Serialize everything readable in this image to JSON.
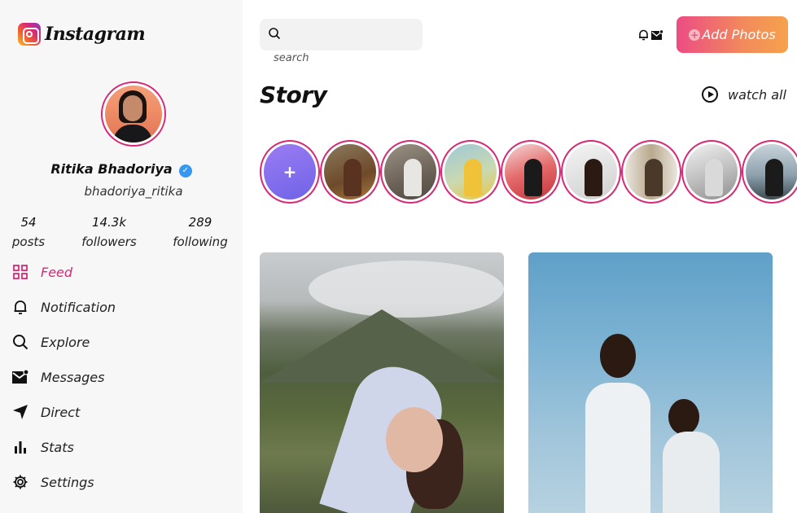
{
  "brand": {
    "name": "Instagram",
    "logo_icon": "instagram-logo-icon"
  },
  "profile": {
    "name": "Ritika Bhadoriya",
    "handle": "bhadoriya_ritika",
    "verified": true,
    "stats": [
      {
        "value": "54",
        "label": "posts"
      },
      {
        "value": "14.3k",
        "label": "followers"
      },
      {
        "value": "289",
        "label": "following"
      }
    ]
  },
  "nav": [
    {
      "label": "Feed",
      "icon": "grid-icon",
      "active": true
    },
    {
      "label": "Notification",
      "icon": "bell-icon",
      "active": false
    },
    {
      "label": "Explore",
      "icon": "search-icon",
      "active": false
    },
    {
      "label": "Messages",
      "icon": "mail-icon",
      "active": false
    },
    {
      "label": "Direct",
      "icon": "send-icon",
      "active": false
    },
    {
      "label": "Stats",
      "icon": "bar-chart-icon",
      "active": false
    },
    {
      "label": "Settings",
      "icon": "gear-icon",
      "active": false
    }
  ],
  "header": {
    "search_caption": "search",
    "add_photos_label": "Add Photos",
    "icons": [
      "bell-icon",
      "mail-icon"
    ]
  },
  "stories": {
    "title": "Story",
    "watch_all_label": "watch all",
    "add_symbol": "+"
  },
  "colors": {
    "accent": "#d62976",
    "button_gradient_start": "#ec4c83",
    "button_gradient_end": "#f6a24c",
    "verified": "#3897f0"
  }
}
